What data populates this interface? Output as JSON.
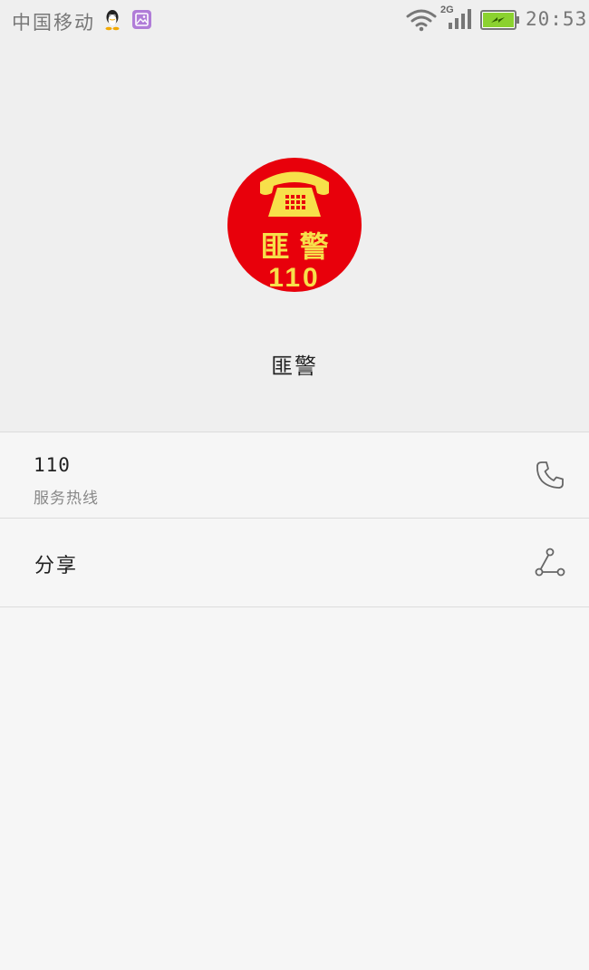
{
  "status_bar": {
    "carrier": "中国移动",
    "network_type": "2G",
    "time": "20:53",
    "icons": [
      "qq-icon",
      "gallery-icon",
      "wifi-icon",
      "signal-icon",
      "battery-charging-icon"
    ]
  },
  "contact": {
    "name": "匪警",
    "avatar": {
      "text_line1": "匪 警",
      "text_line2": "110",
      "background_color": "#e8000b",
      "foreground_color": "#f7e04a"
    }
  },
  "phone_entry": {
    "number": "110",
    "description": "服务热线",
    "icon": "phone-icon"
  },
  "share_entry": {
    "label": "分享",
    "icon": "share-icon"
  },
  "colors": {
    "header_bg": "#efefef",
    "body_bg": "#f6f6f6",
    "divider": "#dcdcdc",
    "battery_fill": "#8bd22f"
  }
}
